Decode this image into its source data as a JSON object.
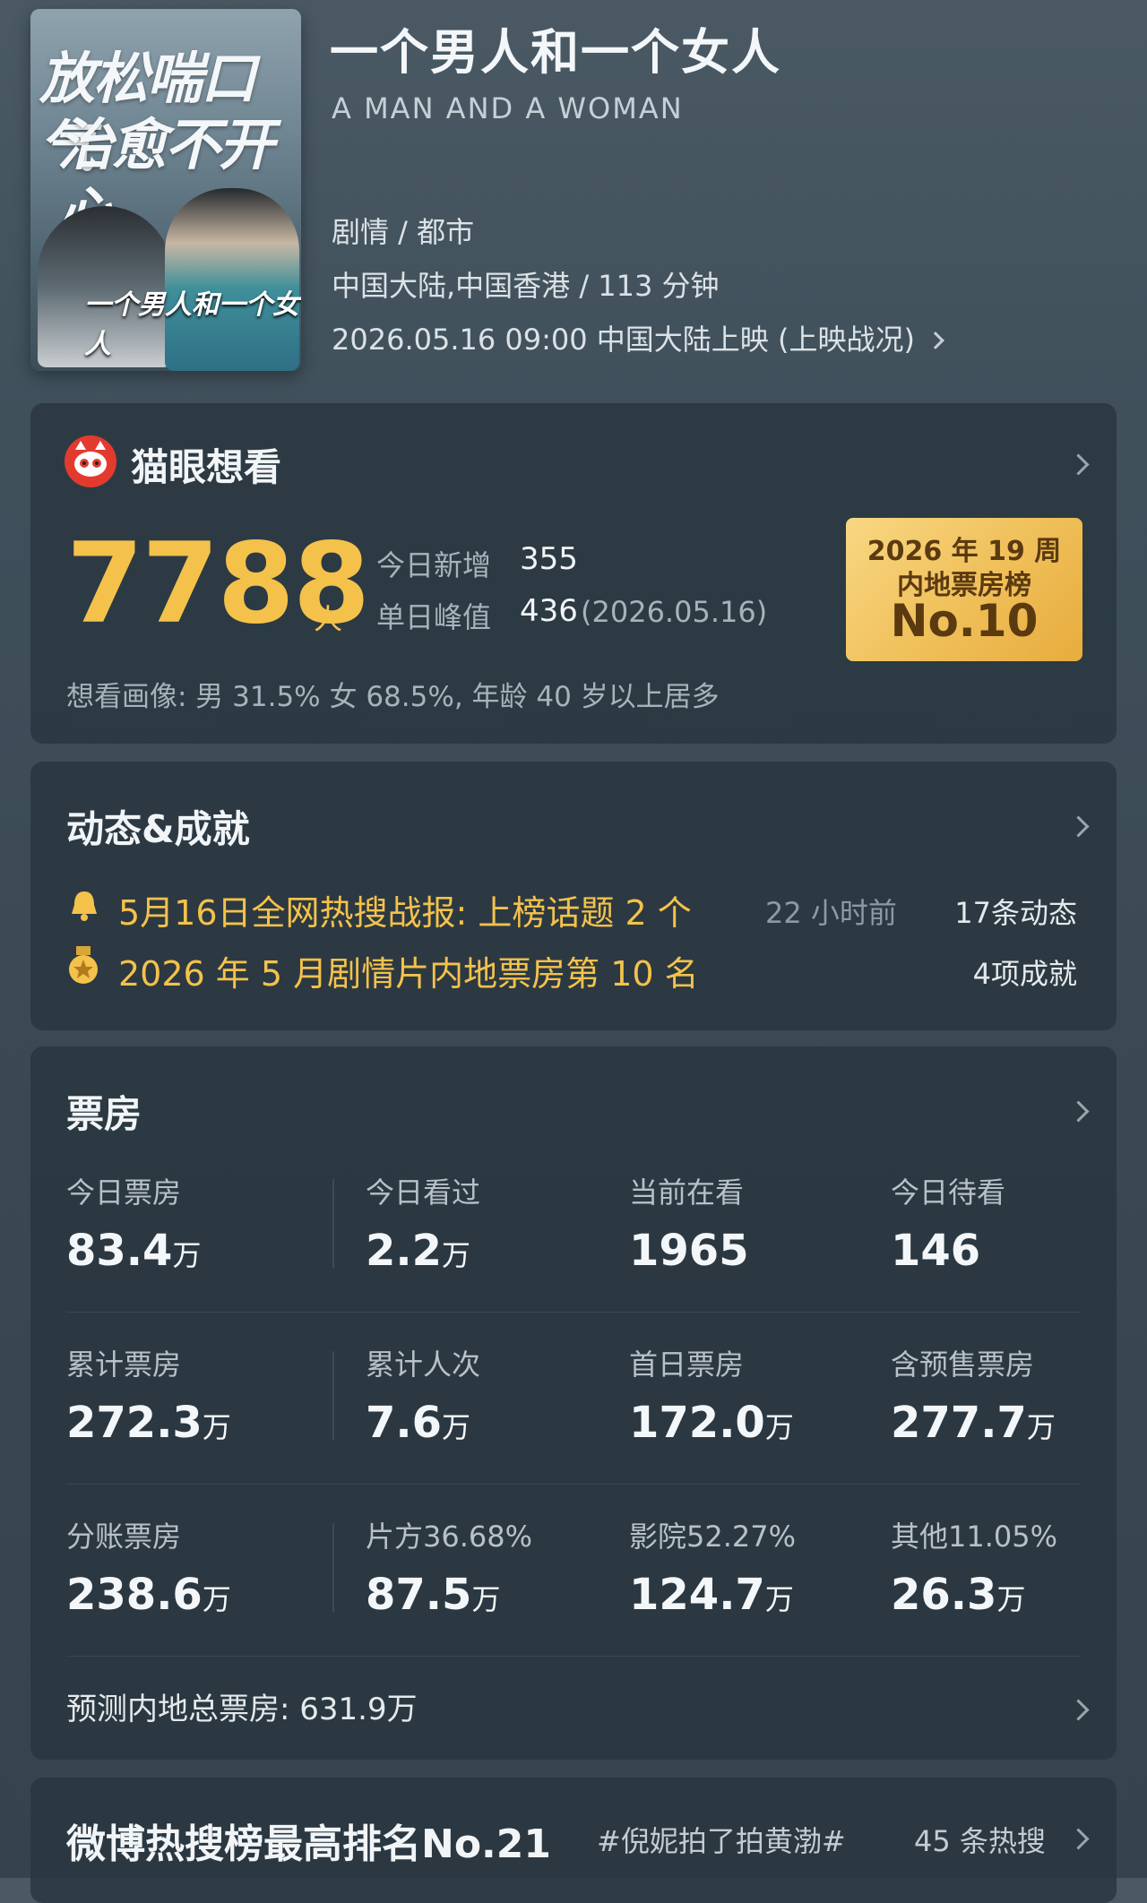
{
  "movie": {
    "poster_tagline_1": "放松喘口气",
    "poster_tagline_2": "治愈不开心",
    "poster_logo": "一个男人和一个女人",
    "title": "一个男人和一个女人",
    "english_title": "A MAN AND A WOMAN",
    "genre": "剧情 / 都市",
    "region_runtime": "中国大陆,中国香港 / 113 分钟",
    "release": "2026.05.16 09:00 中国大陆上映 (上映战况)"
  },
  "want": {
    "title": "猫眼想看",
    "count": "7788",
    "unit": "人",
    "today_new_label": "今日新增",
    "today_new": "355",
    "peak_label": "单日峰值",
    "peak": "436",
    "peak_date": "(2026.05.16)",
    "portrait": "想看画像: 男 31.5%  女 68.5%, 年龄 40 岁以上居多",
    "rank_line1": "2026 年 19 周",
    "rank_line2": "内地票房榜",
    "rank": "No.10"
  },
  "news": {
    "title": "动态&成就",
    "item1": "5月16日全网热搜战报: 上榜话题 2 个",
    "item1_time": "22 小时前",
    "item1_count": "17条动态",
    "item2": "2026 年 5 月剧情片内地票房第 10 名",
    "item2_count": "4项成就"
  },
  "boxoffice": {
    "title": "票房",
    "rows": [
      [
        {
          "label": "今日票房",
          "value": "83.4",
          "unit": "万"
        },
        {
          "label": "今日看过",
          "value": "2.2",
          "unit": "万"
        },
        {
          "label": "当前在看",
          "value": "1965",
          "unit": ""
        },
        {
          "label": "今日待看",
          "value": "146",
          "unit": ""
        }
      ],
      [
        {
          "label": "累计票房",
          "value": "272.3",
          "unit": "万"
        },
        {
          "label": "累计人次",
          "value": "7.6",
          "unit": "万"
        },
        {
          "label": "首日票房",
          "value": "172.0",
          "unit": "万"
        },
        {
          "label": "含预售票房",
          "value": "277.7",
          "unit": "万"
        }
      ],
      [
        {
          "label": "分账票房",
          "value": "238.6",
          "unit": "万"
        },
        {
          "label": "片方36.68%",
          "value": "87.5",
          "unit": "万"
        },
        {
          "label": "影院52.27%",
          "value": "124.7",
          "unit": "万"
        },
        {
          "label": "其他11.05%",
          "value": "26.3",
          "unit": "万"
        }
      ]
    ],
    "forecast": "预测内地总票房: 631.9万"
  },
  "weibo": {
    "title": "微博热搜榜最高排名No.21",
    "tag": "#倪妮拍了拍黄渤#",
    "count": "45 条热搜"
  },
  "colors": {
    "accent": "#f4c24b",
    "badge": "#f0c15c",
    "card": "#28343e"
  }
}
